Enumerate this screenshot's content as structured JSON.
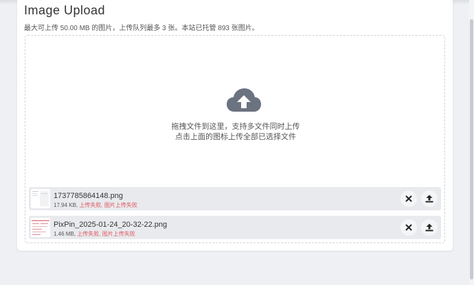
{
  "page": {
    "title": "Image Upload",
    "subtitle": "最大可上传 50.00 MB 的图片，上传队列最多 3 张。本站已托管 893 张图片。"
  },
  "dropzone": {
    "icon": "cloud-upload-icon",
    "line1": "拖拽文件到这里，支持多文件同时上传",
    "line2": "点击上面的图标上传全部已选择文件"
  },
  "files": [
    {
      "name": "1737785864148.png",
      "size": "17.94 KB",
      "status": "上传失败, 图片上传失败"
    },
    {
      "name": "PixPin_2025-01-24_20-32-22.png",
      "size": "1.46 MB",
      "status": "上传失败, 图片上传失败"
    }
  ],
  "colors": {
    "error": "#e0555f",
    "icon": "#6b7280",
    "row_bg": "#e8eaed"
  }
}
